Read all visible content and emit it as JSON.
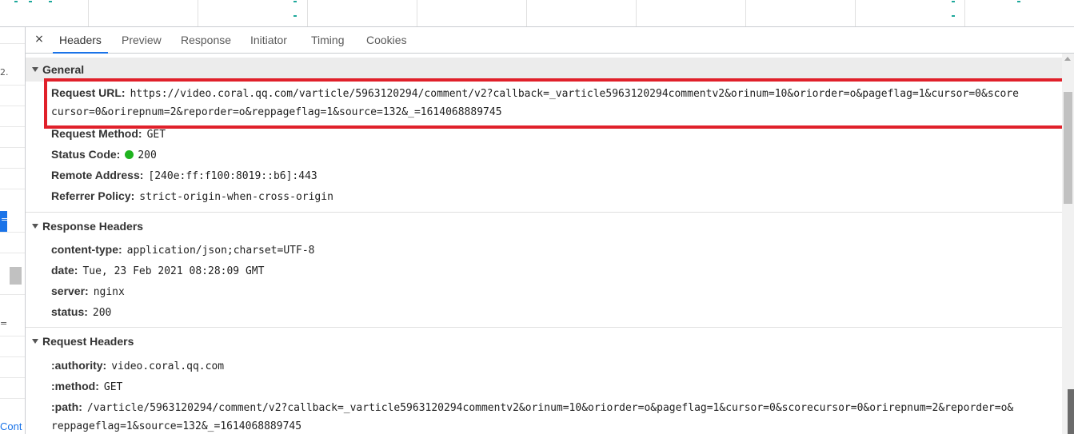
{
  "tabs": [
    {
      "label": "Headers",
      "active": true
    },
    {
      "label": "Preview",
      "active": false
    },
    {
      "label": "Response",
      "active": false
    },
    {
      "label": "Initiator",
      "active": false
    },
    {
      "label": "Timing",
      "active": false
    },
    {
      "label": "Cookies",
      "active": false
    }
  ],
  "close_glyph": "×",
  "left_fragments": {
    "glyph_1": "2.",
    "glyph_2": "=",
    "glyph_3": "=",
    "link": "Cont"
  },
  "general": {
    "title": "General",
    "request_url_key": "Request URL:",
    "request_url_line1": "https://video.coral.qq.com/varticle/5963120294/comment/v2?callback=_varticle5963120294commentv2&orinum=10&oriorder=o&pageflag=1&cursor=0&score",
    "request_url_line2": "cursor=0&orirepnum=2&reporder=o&reppageflag=1&source=132&_=1614068889745",
    "request_method_key": "Request Method:",
    "request_method": "GET",
    "status_code_key": "Status Code:",
    "status_code": "200",
    "status_color": "#1fb31f",
    "remote_address_key": "Remote Address:",
    "remote_address": "[240e:ff:f100:8019::b6]:443",
    "referrer_policy_key": "Referrer Policy:",
    "referrer_policy": "strict-origin-when-cross-origin"
  },
  "response_headers": {
    "title": "Response Headers",
    "items": [
      {
        "key": "content-type:",
        "value": "application/json;charset=UTF-8"
      },
      {
        "key": "date:",
        "value": "Tue, 23 Feb 2021 08:28:09 GMT"
      },
      {
        "key": "server:",
        "value": "nginx"
      },
      {
        "key": "status:",
        "value": "200"
      }
    ]
  },
  "request_headers": {
    "title": "Request Headers",
    "authority_key": ":authority:",
    "authority": "video.coral.qq.com",
    "method_key": ":method:",
    "method": "GET",
    "path_key": ":path:",
    "path_line1": "/varticle/5963120294/comment/v2?callback=_varticle5963120294commentv2&orinum=10&oriorder=o&pageflag=1&cursor=0&scorecursor=0&orirepnum=2&reporder=o&",
    "path_line2": "reppageflag=1&source=132&_=1614068889745"
  },
  "colors": {
    "accent": "#1a73e8",
    "highlight_box": "#e0202a"
  }
}
